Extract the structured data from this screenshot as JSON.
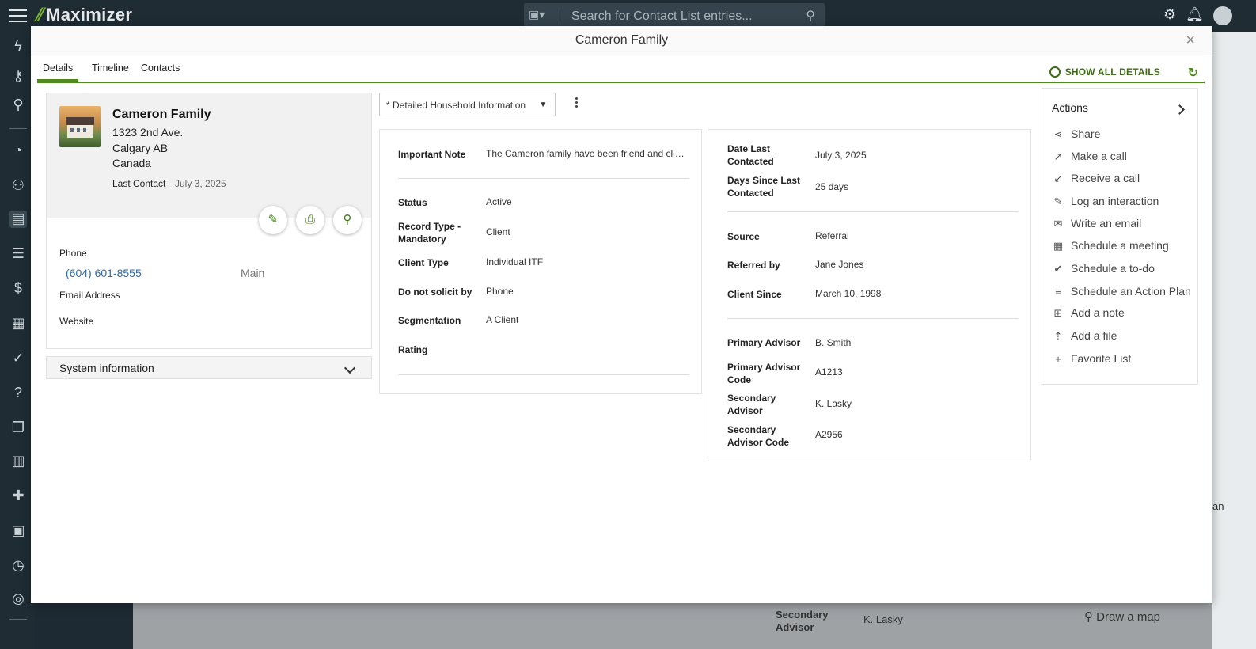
{
  "app": {
    "brand": "Maximizer",
    "search_placeholder": "Search for Contact List entries..."
  },
  "background": {
    "secondary_advisor_label": "Secondary Advisor",
    "secondary_advisor_value": "K. Lasky",
    "draw_map": "Draw a map",
    "partial_text": "an"
  },
  "modal": {
    "title": "Cameron Family",
    "close": "×"
  },
  "tabs": [
    "Details",
    "Timeline",
    "Contacts"
  ],
  "toolbar": {
    "show_all": "SHOW ALL DETAILS"
  },
  "contact": {
    "name": "Cameron Family",
    "address_line1": "1323 2nd Ave.",
    "address_line2": "Calgary AB",
    "address_line3": "Canada",
    "last_contact_label": "Last Contact",
    "last_contact_value": "July 3, 2025",
    "phone_label": "Phone",
    "phone_value": "(604) 601-8555",
    "phone_type": "Main",
    "email_label": "Email Address",
    "website_label": "Website"
  },
  "system_info": "System information",
  "view_select": "* Detailed Household Information",
  "panel_middle": {
    "important_note_label": "Important Note",
    "important_note_value": "The Cameron family have been friend and clie...",
    "fields": [
      {
        "label": "Status",
        "value": "Active"
      },
      {
        "label": "Record Type - Mandatory",
        "value": "Client"
      },
      {
        "label": "Client Type",
        "value": "Individual ITF"
      },
      {
        "label": "Do not solicit by",
        "value": "Phone"
      },
      {
        "label": "Segmentation",
        "value": "A Client"
      },
      {
        "label": "Rating",
        "value": ""
      }
    ]
  },
  "panel_right": {
    "fields": [
      {
        "label": "Date Last Contacted",
        "value": "July 3, 2025"
      },
      {
        "label": "Days Since Last Contacted",
        "value": "25 days"
      },
      {
        "label": "Source",
        "value": "Referral"
      },
      {
        "label": "Referred by",
        "value": "Jane Jones"
      },
      {
        "label": "Client Since",
        "value": "March 10, 1998"
      },
      {
        "label": "Primary Advisor",
        "value": "B. Smith"
      },
      {
        "label": "Primary Advisor Code",
        "value": "A1213"
      },
      {
        "label": "Secondary Advisor",
        "value": "K. Lasky"
      },
      {
        "label": "Secondary Advisor Code",
        "value": "A2956"
      }
    ]
  },
  "actions": {
    "title": "Actions",
    "items": [
      {
        "label": "Share",
        "icon": "share-icon"
      },
      {
        "label": "Make a call",
        "icon": "outgoing-call-icon"
      },
      {
        "label": "Receive a call",
        "icon": "incoming-call-icon"
      },
      {
        "label": "Log an interaction",
        "icon": "edit-icon"
      },
      {
        "label": "Write an email",
        "icon": "email-icon"
      },
      {
        "label": "Schedule a meeting",
        "icon": "calendar-icon"
      },
      {
        "label": "Schedule a to-do",
        "icon": "check-circle-icon"
      },
      {
        "label": "Schedule an Action Plan",
        "icon": "list-icon"
      },
      {
        "label": "Add a note",
        "icon": "note-add-icon"
      },
      {
        "label": "Add a file",
        "icon": "upload-icon"
      },
      {
        "label": "Favorite List",
        "icon": "plus-icon"
      }
    ]
  },
  "colors": {
    "accent": "#4f8a1f",
    "link": "#2d6aa6",
    "app_bar": "#1f2c34"
  }
}
